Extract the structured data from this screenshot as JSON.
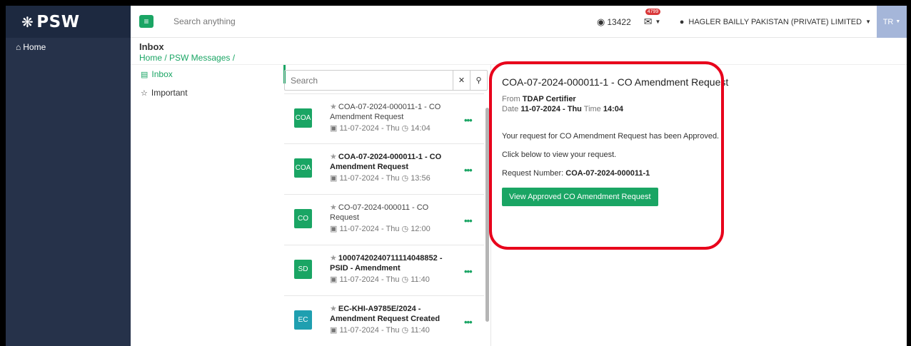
{
  "brand": {
    "logo_text": "PSW"
  },
  "sidebar": {
    "home_label": "Home"
  },
  "topbar": {
    "search_placeholder": "Search anything",
    "token_count": "13422",
    "mail_badge": "4799",
    "user_name": "HAGLER BAILLY PAKISTAN (PRIVATE) LIMITED",
    "lang_label": "TR"
  },
  "page": {
    "title": "Inbox",
    "breadcrumb": "Home / PSW Messages /"
  },
  "folders": [
    {
      "label": "Inbox"
    },
    {
      "label": "Important"
    }
  ],
  "list": {
    "search_placeholder": "Search",
    "messages": [
      {
        "avatar": "COA",
        "avatar_color": "#1aa564",
        "subject": "COA-07-2024-000011-1 - CO Amendment Request",
        "date": "11-07-2024 - Thu",
        "time": "14:04",
        "unread": false
      },
      {
        "avatar": "COA",
        "avatar_color": "#1aa564",
        "subject": "COA-07-2024-000011-1 - CO Amendment Request",
        "date": "11-07-2024 - Thu",
        "time": "13:56",
        "unread": true
      },
      {
        "avatar": "CO",
        "avatar_color": "#1aa564",
        "subject": "CO-07-2024-000011 - CO Request",
        "date": "11-07-2024 - Thu",
        "time": "12:00",
        "unread": false
      },
      {
        "avatar": "SD",
        "avatar_color": "#1aa564",
        "subject": "100074202407111140488​52 - PSID - Amendment",
        "date": "11-07-2024 - Thu",
        "time": "11:40",
        "unread": true
      },
      {
        "avatar": "EC",
        "avatar_color": "#1f9fb0",
        "subject": "EC-KHI-A9785E/2024 - Amendment Request Created",
        "date": "11-07-2024 - Thu",
        "time": "11:40",
        "unread": true
      }
    ]
  },
  "reader": {
    "subject": "COA-07-2024-000011-1 - CO Amendment Request",
    "from_label": "From",
    "from_value": "TDAP Certifier",
    "date_label": "Date",
    "date_value": "11-07-2024 - Thu",
    "time_label": "Time",
    "time_value": "14:04",
    "body_1": "Your request for CO Amendment Request has been Approved.",
    "body_2": "Click below to view your request.",
    "request_label": "Request Number:",
    "request_value": "COA-07-2024-000011-1",
    "button_label": "View Approved CO Amendment Request"
  },
  "colors": {
    "accent": "#1aa564",
    "sidebar": "#26324a",
    "highlight": "#e8001b"
  }
}
